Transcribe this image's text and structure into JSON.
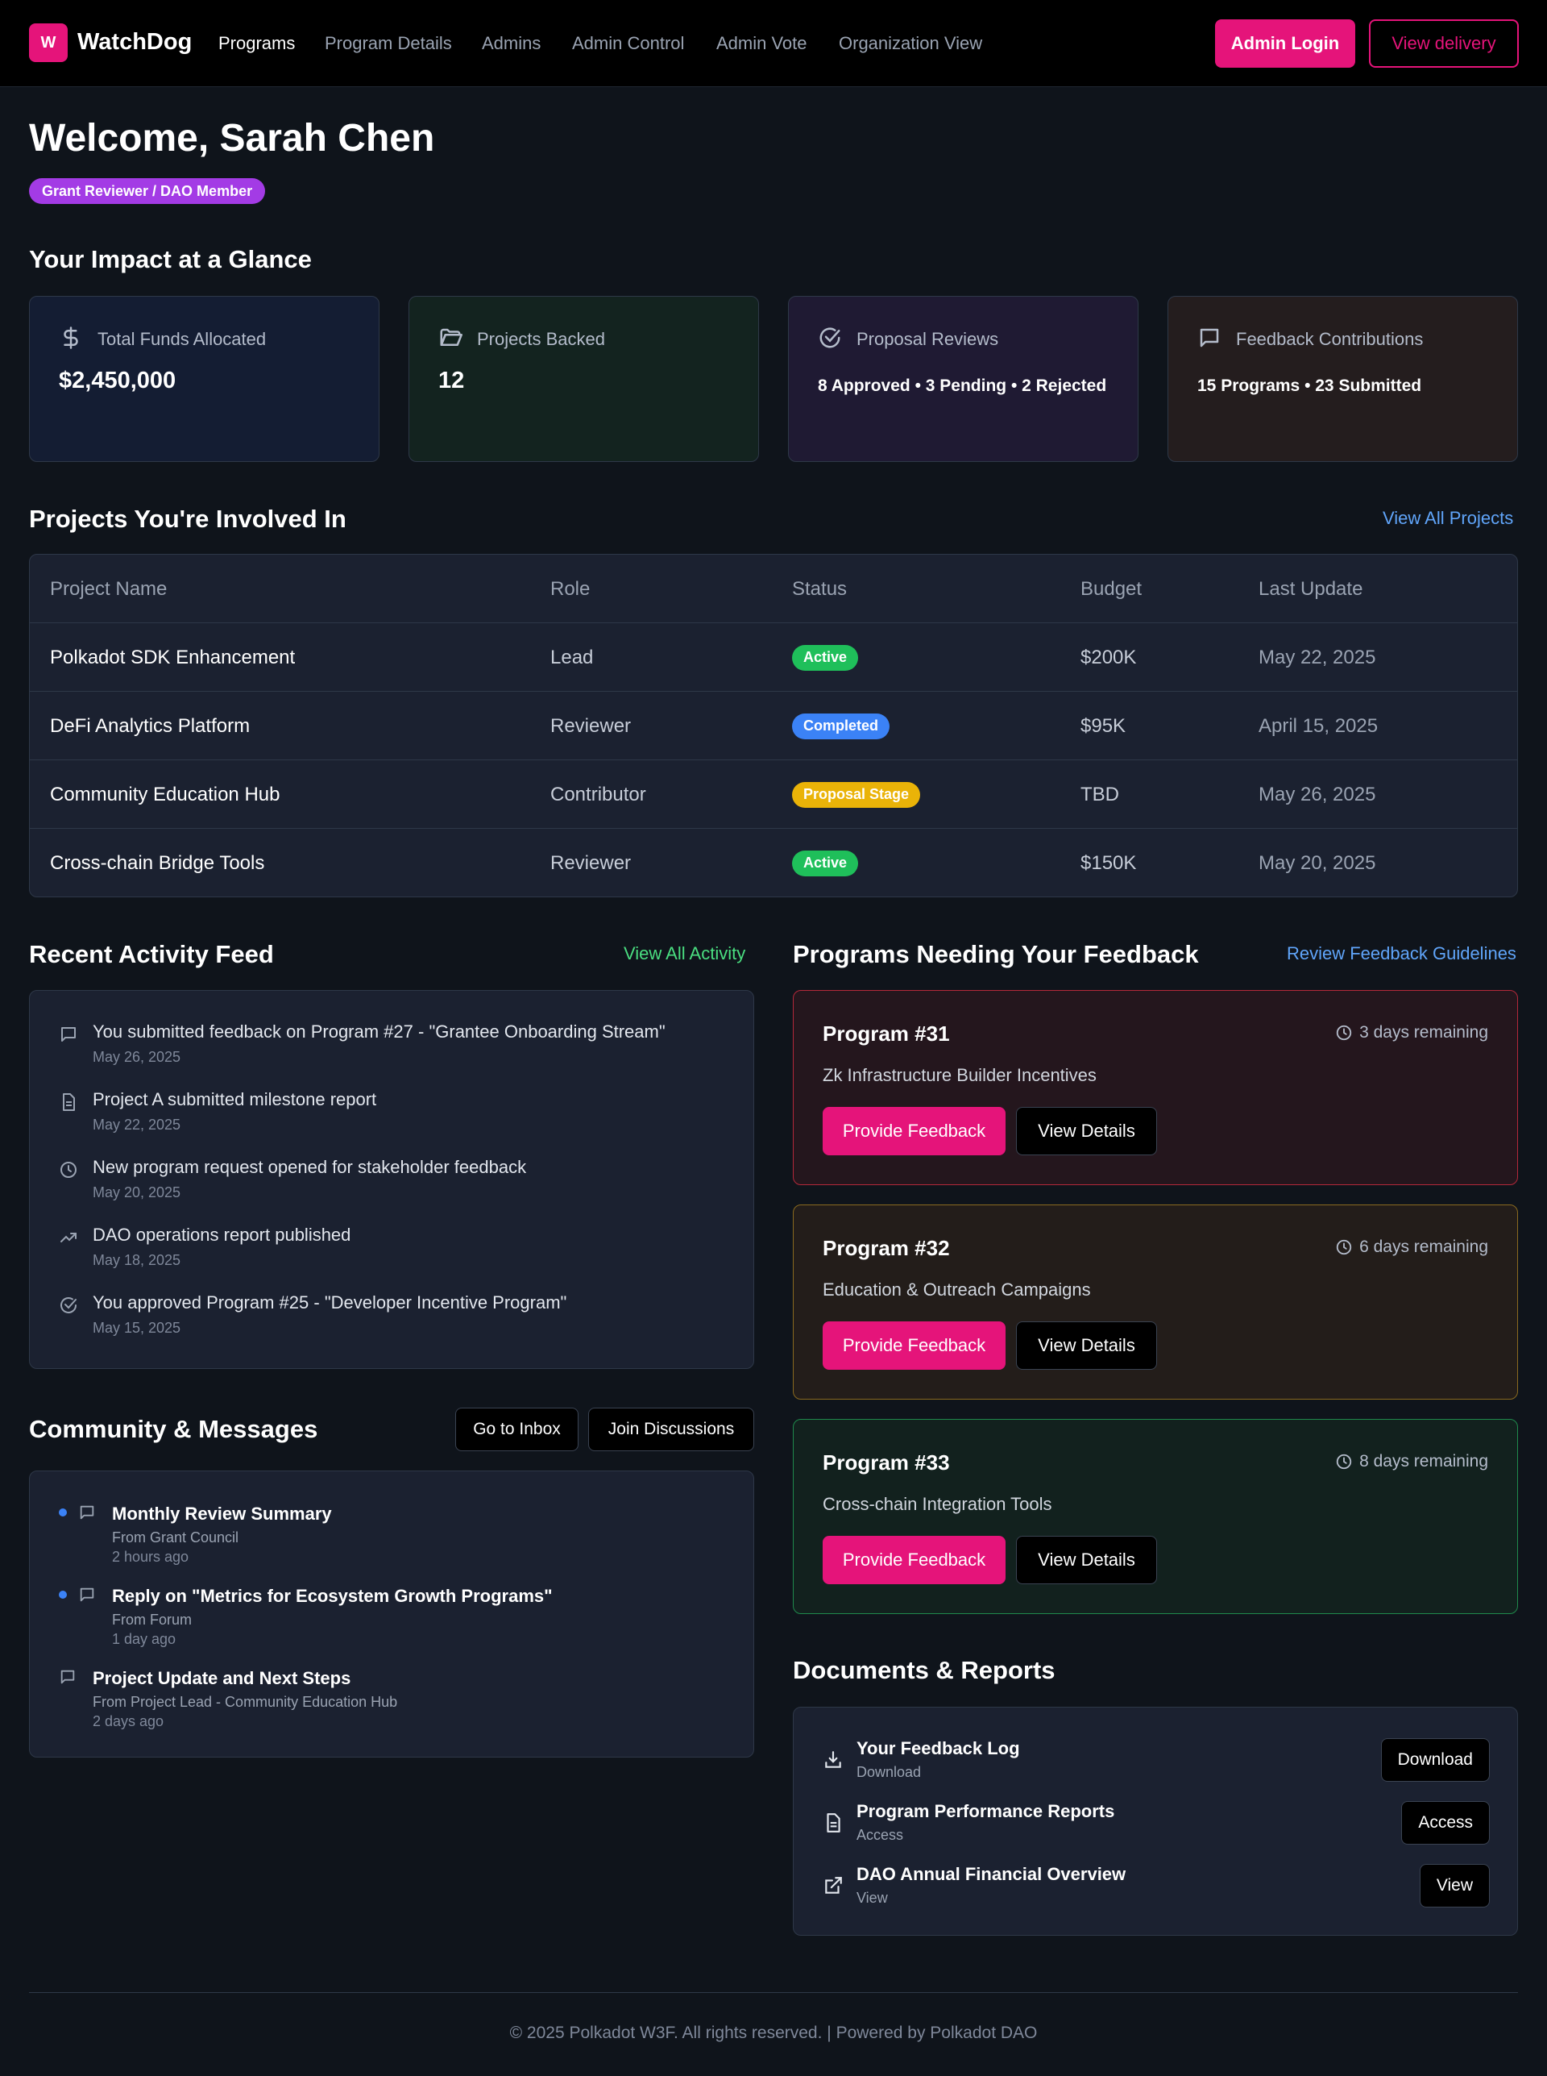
{
  "nav": {
    "logo_letter": "W",
    "brand": "WatchDog",
    "links": [
      "Programs",
      "Program Details",
      "Admins",
      "Admin Control",
      "Admin Vote",
      "Organization View"
    ],
    "admin_login": "Admin Login",
    "view_delivery": "View delivery"
  },
  "header": {
    "welcome": "Welcome, Sarah Chen",
    "role_badge": "Grant Reviewer / DAO Member"
  },
  "impact": {
    "title": "Your Impact at a Glance",
    "cards": [
      {
        "label": "Total Funds Allocated",
        "value": "$2,450,000",
        "icon": "dollar-icon"
      },
      {
        "label": "Projects Backed",
        "value": "12",
        "icon": "folder-icon"
      },
      {
        "label": "Proposal Reviews",
        "value": "8 Approved • 3 Pending • 2 Rejected",
        "icon": "check-circle-icon"
      },
      {
        "label": "Feedback Contributions",
        "value": "15 Programs • 23 Submitted",
        "icon": "message-icon"
      }
    ]
  },
  "projects": {
    "title": "Projects You're Involved In",
    "view_all": "View All Projects",
    "headers": [
      "Project Name",
      "Role",
      "Status",
      "Budget",
      "Last Update"
    ],
    "rows": [
      {
        "name": "Polkadot SDK Enhancement",
        "role": "Lead",
        "status": "Active",
        "budget": "$200K",
        "updated": "May 22, 2025"
      },
      {
        "name": "DeFi Analytics Platform",
        "role": "Reviewer",
        "status": "Completed",
        "budget": "$95K",
        "updated": "April 15, 2025"
      },
      {
        "name": "Community Education Hub",
        "role": "Contributor",
        "status": "Proposal Stage",
        "budget": "TBD",
        "updated": "May 26, 2025"
      },
      {
        "name": "Cross-chain Bridge Tools",
        "role": "Reviewer",
        "status": "Active",
        "budget": "$150K",
        "updated": "May 20, 2025"
      }
    ],
    "status_colors": {
      "Active": "#1fbf5a",
      "Completed": "#3b82f6",
      "Proposal Stage": "#eab308"
    }
  },
  "activity": {
    "title": "Recent Activity Feed",
    "view_all": "View All Activity",
    "items": [
      {
        "text": "You submitted feedback on Program #27 - \"Grantee Onboarding Stream\"",
        "date": "May 26, 2025",
        "icon": "message-icon"
      },
      {
        "text": "Project A submitted milestone report",
        "date": "May 22, 2025",
        "icon": "file-icon"
      },
      {
        "text": "New program request opened for stakeholder feedback",
        "date": "May 20, 2025",
        "icon": "clock-icon"
      },
      {
        "text": "DAO operations report published",
        "date": "May 18, 2025",
        "icon": "trend-icon"
      },
      {
        "text": "You approved Program #25 - \"Developer Incentive Program\"",
        "date": "May 15, 2025",
        "icon": "check-circle-icon"
      }
    ]
  },
  "community": {
    "title": "Community & Messages",
    "inbox": "Go to Inbox",
    "discussions": "Join Discussions",
    "messages": [
      {
        "title": "Monthly Review Summary",
        "from": "From Grant Council",
        "time": "2 hours ago",
        "unread": true
      },
      {
        "title": "Reply on \"Metrics for Ecosystem Growth Programs\"",
        "from": "From Forum",
        "time": "1 day ago",
        "unread": true
      },
      {
        "title": "Project Update and Next Steps",
        "from": "From Project Lead - Community Education Hub",
        "time": "2 days ago",
        "unread": false
      }
    ]
  },
  "feedback": {
    "title": "Programs Needing Your Feedback",
    "guidelines": "Review Feedback Guidelines",
    "provide_label": "Provide Feedback",
    "details_label": "View Details",
    "programs": [
      {
        "title": "Program #31",
        "remaining": "3 days remaining",
        "subtitle": "Zk Infrastructure Builder Incentives"
      },
      {
        "title": "Program #32",
        "remaining": "6 days remaining",
        "subtitle": "Education & Outreach Campaigns"
      },
      {
        "title": "Program #33",
        "remaining": "8 days remaining",
        "subtitle": "Cross-chain Integration Tools"
      }
    ]
  },
  "documents": {
    "title": "Documents & Reports",
    "items": [
      {
        "title": "Your Feedback Log",
        "sub": "Download",
        "button": "Download",
        "icon": "download-icon"
      },
      {
        "title": "Program Performance Reports",
        "sub": "Access",
        "button": "Access",
        "icon": "file-icon"
      },
      {
        "title": "DAO Annual Financial Overview",
        "sub": "View",
        "button": "View",
        "icon": "external-link-icon"
      }
    ]
  },
  "footer": {
    "text": "© 2025 Polkadot W3F. All rights reserved. | Powered by Polkadot DAO"
  },
  "colors": {
    "accent": "#e5147a",
    "badge_purple": "#a33be5",
    "link_blue": "#60a5fa",
    "link_green": "#4ade80"
  }
}
